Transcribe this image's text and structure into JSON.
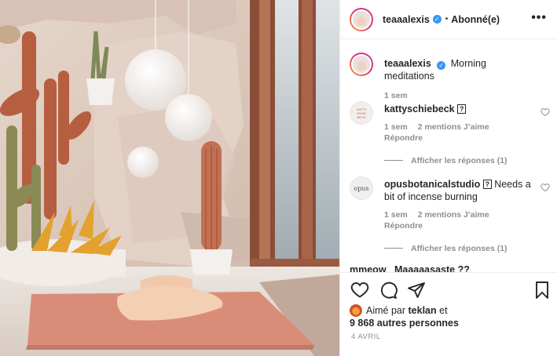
{
  "header": {
    "username": "teaaalexis",
    "verified_mark": "✓",
    "separator": "•",
    "follow_status": "Abonné(e)",
    "more_icon": "•••"
  },
  "caption": {
    "username": "teaaalexis",
    "text": "Morning meditations",
    "time": "1 sem"
  },
  "comments": [
    {
      "username": "kattyschiebeck",
      "avatar_text": "KATTY SCHIE BECK",
      "text": "",
      "marker": "?",
      "time": "1 sem",
      "likes": "2 mentions J’aime",
      "reply": "Répondre",
      "view_replies": "Afficher les réponses (1)"
    },
    {
      "username": "opusbotanicalstudio",
      "avatar_text": "opus",
      "marker": "?",
      "text": "Needs a bit of incense burning",
      "time": "1 sem",
      "likes": "2 mentions J’aime",
      "reply": "Répondre",
      "view_replies": "Afficher les réponses (1)"
    }
  ],
  "cut_comment": {
    "text": "mmeow_ Maaaaasaste ??"
  },
  "actions": {
    "liked_by_prefix": "Aimé par",
    "liked_by_user": "teklan",
    "liked_by_mid": "et",
    "others": "9 868 autres personnes",
    "date": "4 AVRIL"
  },
  "colors": {
    "verified": "#3897f0",
    "muted": "#8e8e8e",
    "text": "#262626",
    "border": "#efefef"
  }
}
